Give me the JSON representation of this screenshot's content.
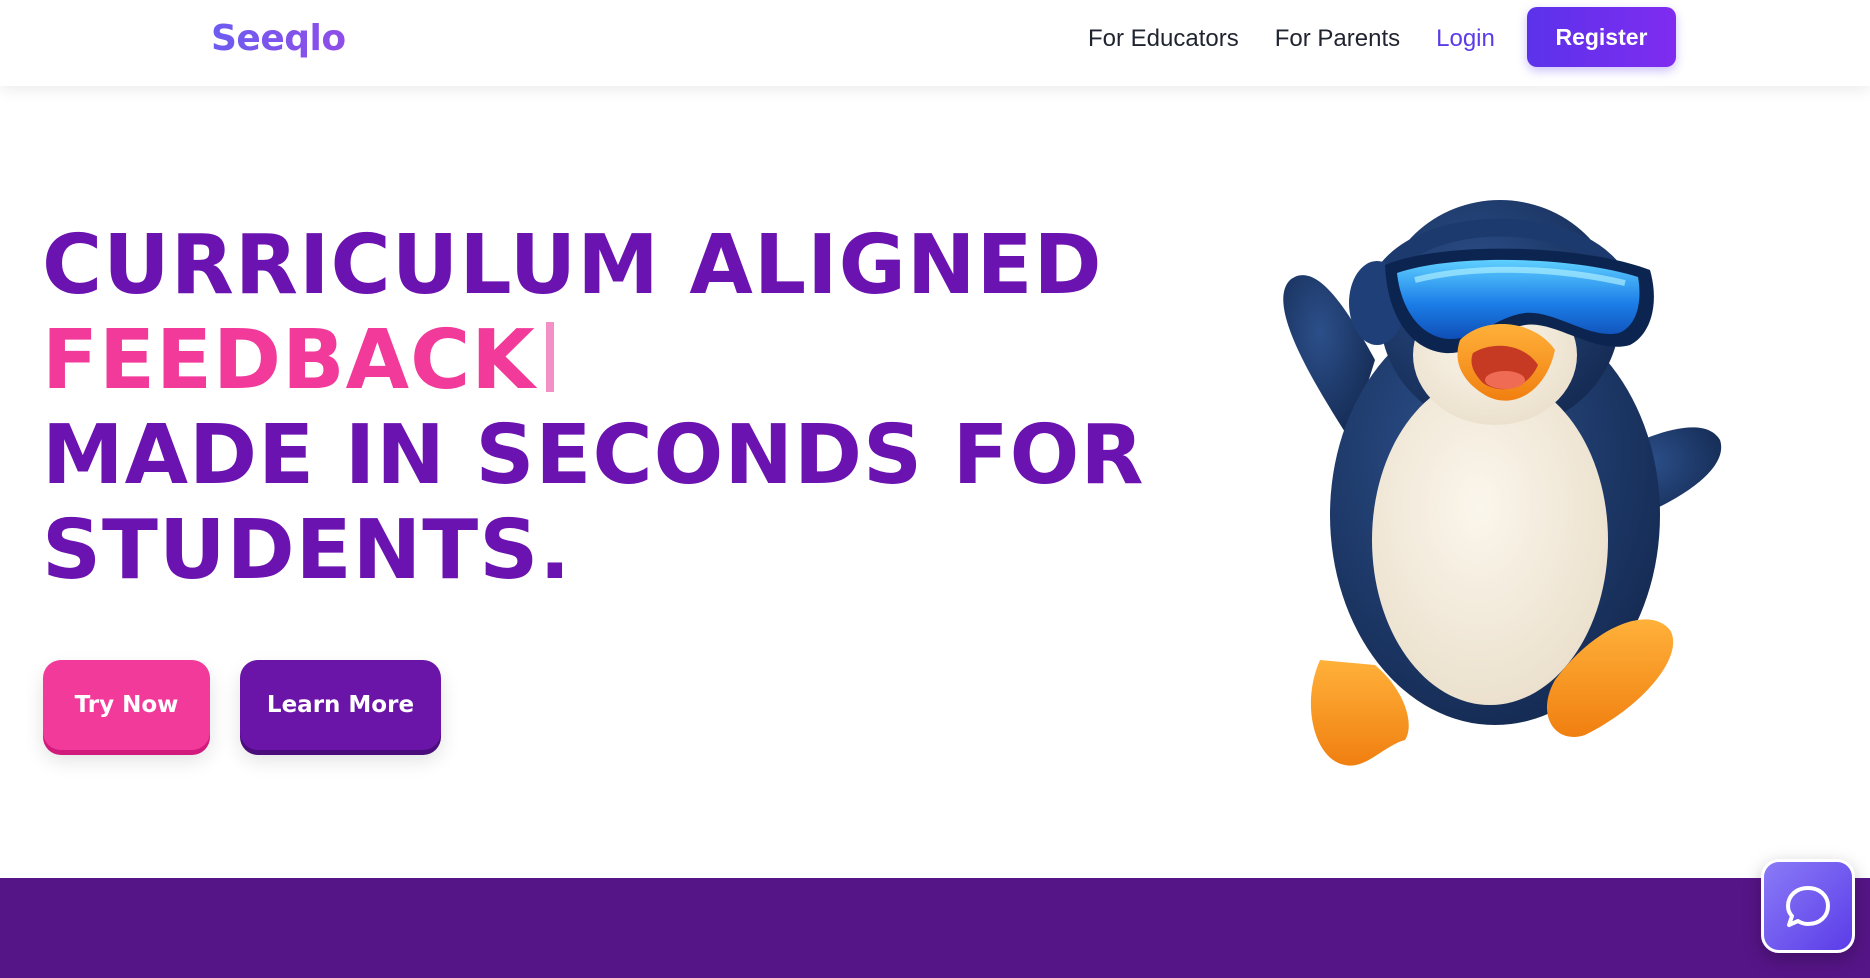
{
  "nav": {
    "logo": "Seeqlo",
    "links": [
      "For Educators",
      "For Parents",
      "Login"
    ],
    "register": "Register"
  },
  "hero": {
    "line1": "CURRICULUM ALIGNED",
    "line2": "FEEDBACK",
    "line3": "MADE IN SECONDS FOR",
    "line4": "STUDENTS."
  },
  "buttons": {
    "try_now": "Try Now",
    "learn_more": "Learn More"
  },
  "icons": {
    "chat": "chat-bubble-icon",
    "mascot": "penguin-mascot"
  },
  "colors": {
    "brand_purple": "#6b13b0",
    "accent_pink": "#f23a9a",
    "register_violet": "#5b32ea",
    "footer_purple": "#561587"
  }
}
